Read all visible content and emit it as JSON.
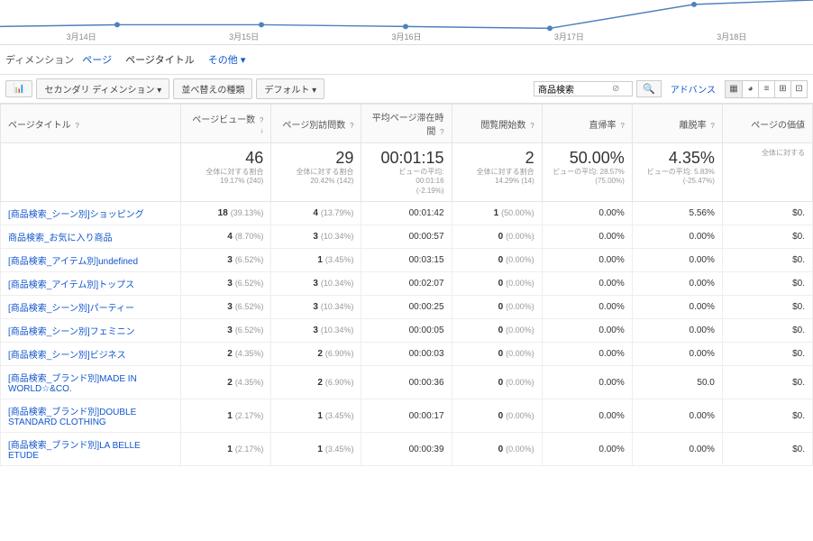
{
  "chart_data": {
    "type": "line",
    "categories": [
      "3月14日",
      "3月15日",
      "3月16日",
      "3月17日",
      "3月18日"
    ],
    "values": [
      5,
      5,
      4,
      3,
      30
    ],
    "title": "",
    "xlabel": "",
    "ylabel": ""
  },
  "dimensions": {
    "label": "ディメンション",
    "primary": "ページ",
    "secondary": "ページタイトル",
    "other": "その他 ▾"
  },
  "toolbar": {
    "plot_rows": "",
    "secondary_dim": "セカンダリ ディメンション ▾",
    "sort_type": "並べ替えの種類",
    "default": "デフォルト ▾",
    "search_value": "商品検索",
    "advanced": "アドバンス"
  },
  "columns": [
    {
      "key": "title",
      "label": "ページタイトル"
    },
    {
      "key": "pageviews",
      "label": "ページビュー数"
    },
    {
      "key": "unique",
      "label": "ページ別訪問数"
    },
    {
      "key": "avg_time",
      "label": "平均ページ滞在時間"
    },
    {
      "key": "entrances",
      "label": "閲覧開始数"
    },
    {
      "key": "bounce",
      "label": "直帰率"
    },
    {
      "key": "exit",
      "label": "離脱率"
    },
    {
      "key": "value",
      "label": "ページの価値"
    }
  ],
  "summary": {
    "pageviews": {
      "big": "46",
      "sub1": "全体に対する割合",
      "sub2": "19.17% (240)"
    },
    "unique": {
      "big": "29",
      "sub1": "全体に対する割合",
      "sub2": "20.42% (142)"
    },
    "avg_time": {
      "big": "00:01:15",
      "sub1": "ビューの平均: 00:01:16",
      "sub2": "(-2.19%)"
    },
    "entrances": {
      "big": "2",
      "sub1": "全体に対する割合",
      "sub2": "14.29% (14)"
    },
    "bounce": {
      "big": "50.00%",
      "sub1": "ビューの平均: 28.57%",
      "sub2": "(75.00%)"
    },
    "exit": {
      "big": "4.35%",
      "sub1": "ビューの平均: 5.83%",
      "sub2": "(-25.47%)"
    },
    "value": {
      "big": "",
      "sub1": "全体に対する",
      "sub2": ""
    }
  },
  "rows": [
    {
      "title": "[商品検索_シーン別]ショッピング",
      "pv": "18",
      "pv_pct": "(39.13%)",
      "uv": "4",
      "uv_pct": "(13.79%)",
      "time": "00:01:42",
      "ent": "1",
      "ent_pct": "(50.00%)",
      "bounce": "0.00%",
      "exit": "5.56%",
      "val": "$0."
    },
    {
      "title": "商品検索_お気に入り商品",
      "pv": "4",
      "pv_pct": "(8.70%)",
      "uv": "3",
      "uv_pct": "(10.34%)",
      "time": "00:00:57",
      "ent": "0",
      "ent_pct": "(0.00%)",
      "bounce": "0.00%",
      "exit": "0.00%",
      "val": "$0."
    },
    {
      "title": "[商品検索_アイテム別]undefined",
      "pv": "3",
      "pv_pct": "(6.52%)",
      "uv": "1",
      "uv_pct": "(3.45%)",
      "time": "00:03:15",
      "ent": "0",
      "ent_pct": "(0.00%)",
      "bounce": "0.00%",
      "exit": "0.00%",
      "val": "$0."
    },
    {
      "title": "[商品検索_アイテム別]トップス",
      "pv": "3",
      "pv_pct": "(6.52%)",
      "uv": "3",
      "uv_pct": "(10.34%)",
      "time": "00:02:07",
      "ent": "0",
      "ent_pct": "(0.00%)",
      "bounce": "0.00%",
      "exit": "0.00%",
      "val": "$0."
    },
    {
      "title": "[商品検索_シーン別]パーティー",
      "pv": "3",
      "pv_pct": "(6.52%)",
      "uv": "3",
      "uv_pct": "(10.34%)",
      "time": "00:00:25",
      "ent": "0",
      "ent_pct": "(0.00%)",
      "bounce": "0.00%",
      "exit": "0.00%",
      "val": "$0."
    },
    {
      "title": "[商品検索_シーン別]フェミニン",
      "pv": "3",
      "pv_pct": "(6.52%)",
      "uv": "3",
      "uv_pct": "(10.34%)",
      "time": "00:00:05",
      "ent": "0",
      "ent_pct": "(0.00%)",
      "bounce": "0.00%",
      "exit": "0.00%",
      "val": "$0."
    },
    {
      "title": "[商品検索_シーン別]ビジネス",
      "pv": "2",
      "pv_pct": "(4.35%)",
      "uv": "2",
      "uv_pct": "(6.90%)",
      "time": "00:00:03",
      "ent": "0",
      "ent_pct": "(0.00%)",
      "bounce": "0.00%",
      "exit": "0.00%",
      "val": "$0."
    },
    {
      "title": "[商品検索_ブランド別]MADE IN WORLD☆&CO.",
      "pv": "2",
      "pv_pct": "(4.35%)",
      "uv": "2",
      "uv_pct": "(6.90%)",
      "time": "00:00:36",
      "ent": "0",
      "ent_pct": "(0.00%)",
      "bounce": "0.00%",
      "exit": "50.0",
      "val": "$0."
    },
    {
      "title": "[商品検索_ブランド別]DOUBLE STANDARD CLOTHING",
      "pv": "1",
      "pv_pct": "(2.17%)",
      "uv": "1",
      "uv_pct": "(3.45%)",
      "time": "00:00:17",
      "ent": "0",
      "ent_pct": "(0.00%)",
      "bounce": "0.00%",
      "exit": "0.00%",
      "val": "$0."
    },
    {
      "title": "[商品検索_ブランド別]LA BELLE ETUDE",
      "pv": "1",
      "pv_pct": "(2.17%)",
      "uv": "1",
      "uv_pct": "(3.45%)",
      "time": "00:00:39",
      "ent": "0",
      "ent_pct": "(0.00%)",
      "bounce": "0.00%",
      "exit": "0.00%",
      "val": "$0."
    }
  ]
}
